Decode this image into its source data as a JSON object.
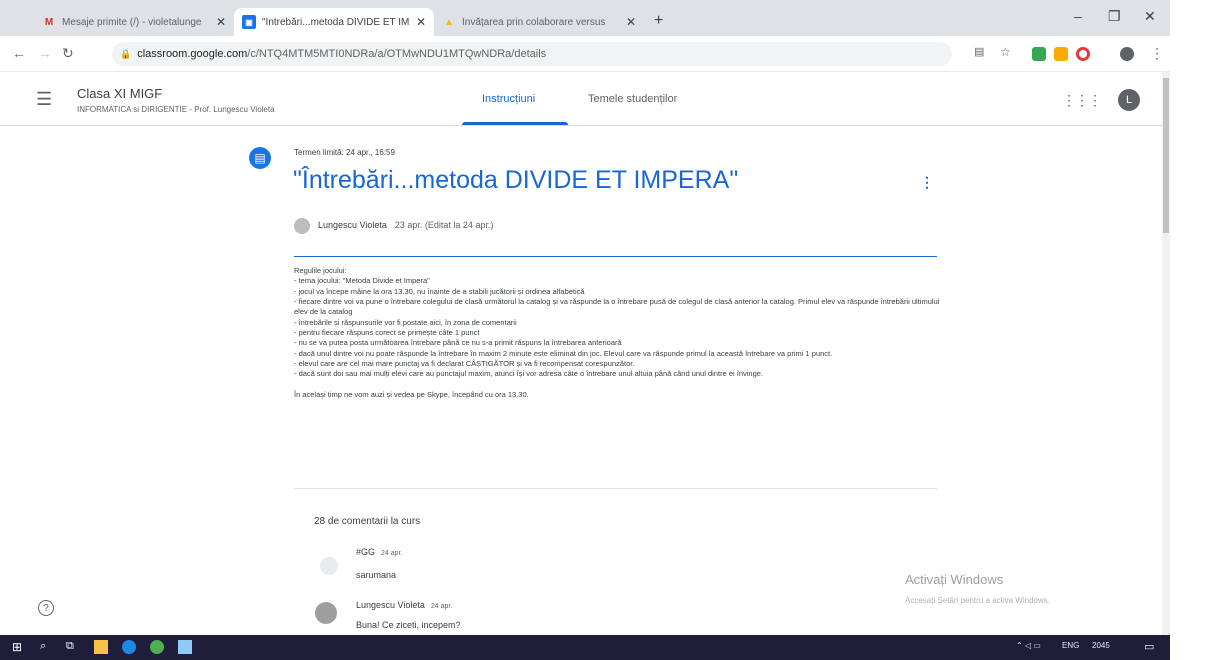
{
  "browser": {
    "tabs": [
      {
        "favicon": "gmail-icon",
        "title": "Mesaje primite (/) - violetalunge"
      },
      {
        "favicon": "classroom-icon",
        "title": "\"Întrebări...metoda DIVIDE ET IM"
      },
      {
        "favicon": "drive-icon",
        "title": "Învățarea prin colaborare versus"
      }
    ],
    "new_tab": "+",
    "url_host": "classroom.google.com",
    "url_path": "/c/NTQ4MTM5MTI0NDRa/a/OTMwNDU1MTQwNDRa/details"
  },
  "classroom": {
    "class_name": "Clasa XI MIGF",
    "class_subtitle": "INFORMATICA si DIRIGENTIE - Prof. Lungescu Violeta",
    "tabs": [
      "Instrucțiuni",
      "Temele studenților"
    ],
    "avatar_letter": "L"
  },
  "assignment": {
    "deadline": "Termen limită: 24 apr., 16:59",
    "title": "\"Întrebări...metoda DIVIDE ET IMPERA\"",
    "author": "Lungescu Violeta",
    "meta": "23 apr. (Editat la 24 apr.)",
    "description": [
      "Regulile jocului:",
      "- tema jocului: \"Metoda Divide et Impera\"",
      "- jocul va începe mâine la ora 13.30, nu înainte de a stabili jucătorii și ordinea alfabetică",
      "- fiecare dintre voi va pune o întrebare colegului de clasă următorul la catalog și va răspunde la o întrebare pusă de colegul de clasă anterior la catalog. Primul elev va răspunde întrebării ultimului elev de la catalog",
      "- întrebările și răspunsurile vor fi postate aici, în zona de comentarii",
      "- pentru fiecare răspuns corect se primește câte 1 punct",
      "- nu se va putea posta următoarea întrebare până ce nu s-a primit răspuns la întrebarea anterioară",
      "- dacă unul dintre voi nu poate răspunde la întrebare în maxim 2 minute este eliminat din joc. Elevul care va răspunde primul la această întrebare va primi 1 punct.",
      "- elevul care are cel mai mare punctaj va fi declarat CÂȘTIGĂTOR și va fi recompensat corespunzător.",
      "- dacă sunt doi sau mai mulți elevi care au punctajul maxim, atunci își vor adresa câte o întrebare unul altuia până când unul dintre ei învinge."
    ],
    "closing": "În același timp ne vom auzi și vedea pe Skype, începând cu ora 13.30."
  },
  "comments": {
    "header": "28 de comentarii la curs",
    "items": [
      {
        "name": "#GG",
        "date": "24 apr.",
        "text": "sarumana"
      },
      {
        "name": "Lungescu Violeta",
        "date": "24 apr.",
        "text": "Buna! Ce ziceti, incepem?"
      }
    ]
  },
  "watermark": {
    "line1": "Activați Windows",
    "line2": "Accesați Setări pentru a activa Windows."
  },
  "taskbar": {
    "language": "ENG",
    "time": "2045"
  },
  "colors": {
    "accent": "#1967d2",
    "taskbar": "#1e1e3a"
  }
}
